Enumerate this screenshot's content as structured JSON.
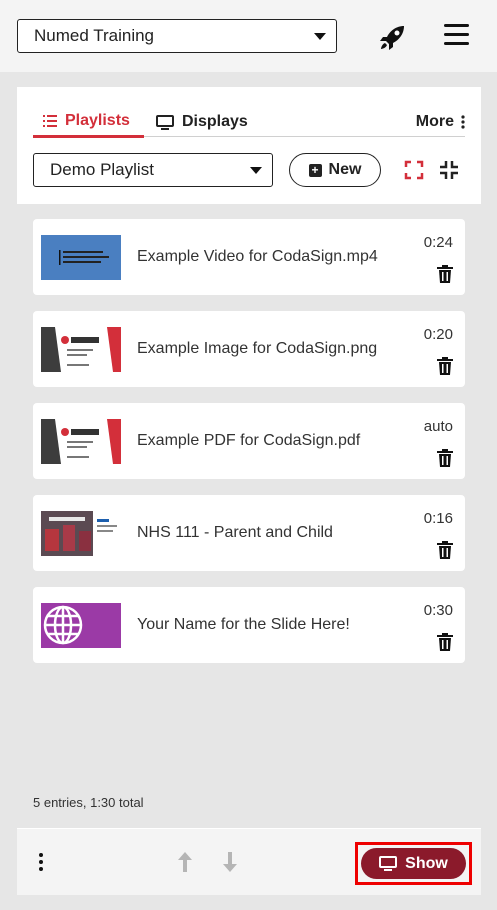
{
  "header": {
    "organization": "Numed Training",
    "rocket_icon": "rocket-icon",
    "menu_icon": "hamburger-icon"
  },
  "tabs": {
    "playlists": "Playlists",
    "displays": "Displays",
    "more": "More"
  },
  "controls": {
    "playlist_selected": "Demo Playlist",
    "new_label": "New"
  },
  "items": [
    {
      "title": "Example Video for CodaSign.mp4",
      "duration": "0:24",
      "thumb": "video"
    },
    {
      "title": "Example Image for CodaSign.png",
      "duration": "0:20",
      "thumb": "codasign"
    },
    {
      "title": "Example PDF for CodaSign.pdf",
      "duration": "auto",
      "thumb": "codasign"
    },
    {
      "title": "NHS 111 - Parent and Child",
      "duration": "0:16",
      "thumb": "nhs"
    },
    {
      "title": "Your Name for the Slide Here!",
      "duration": "0:30",
      "thumb": "globe"
    }
  ],
  "summary": "5 entries, 1:30 total",
  "footer": {
    "show_label": "Show"
  },
  "colors": {
    "accent": "#d32f3a",
    "show_button": "#8b1a2b"
  }
}
